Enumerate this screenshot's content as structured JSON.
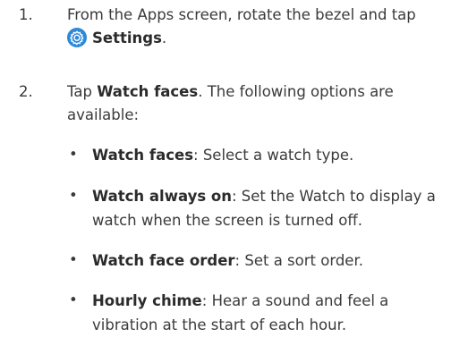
{
  "steps": [
    {
      "number": "1.",
      "line1": "From the Apps screen, rotate the bezel and tap",
      "icon": "settings-gear-icon",
      "bold": "Settings",
      "tail": "."
    },
    {
      "number": "2.",
      "text1": "Tap ",
      "bold": "Watch faces",
      "text2": ". The following options are",
      "line2": "available:"
    }
  ],
  "bullets": [
    {
      "symbol": "•",
      "bold": "Watch faces",
      "text": ": Select a watch type."
    },
    {
      "symbol": "•",
      "bold": "Watch always on",
      "text": ": Set the Watch to display a",
      "line2": "watch when the screen is turned off."
    },
    {
      "symbol": "•",
      "bold": "Watch face order",
      "text": ": Set a sort order."
    },
    {
      "symbol": "•",
      "bold": "Hourly chime",
      "text": ": Hear a sound and feel a",
      "line2": "vibration at the start of each hour."
    }
  ],
  "colors": {
    "text": "#3a3a3a",
    "icon_bg": "#2e88d8"
  }
}
